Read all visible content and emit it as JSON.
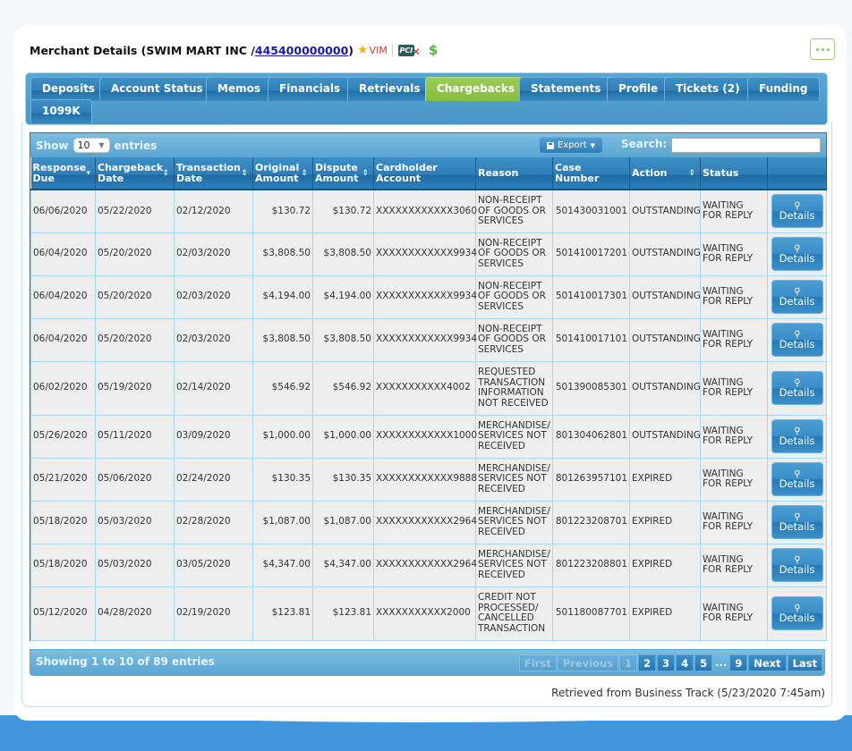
{
  "header": {
    "title_prefix": "Merchant Details (SWIM MART INC / ",
    "merchant_id": "445400000000",
    "title_suffix": ")",
    "vim_label": "VIM",
    "pci_label": "PCI",
    "dollar_label": "$"
  },
  "tabs": [
    {
      "label": "Deposits",
      "active": false
    },
    {
      "label": "Account Status",
      "active": false
    },
    {
      "label": "Memos",
      "active": false
    },
    {
      "label": "Financials",
      "active": false
    },
    {
      "label": "Retrievals",
      "active": false
    },
    {
      "label": "Chargebacks",
      "active": true
    },
    {
      "label": "Statements",
      "active": false
    },
    {
      "label": "Profile",
      "active": false
    },
    {
      "label": "Tickets (2)",
      "active": false
    },
    {
      "label": "Funding",
      "active": false
    },
    {
      "label": "1099K",
      "active": false
    }
  ],
  "toolbar": {
    "show_label": "Show",
    "page_length": "10",
    "entries_label": "entries",
    "export_label": "Export",
    "search_label": "Search:",
    "search_value": ""
  },
  "columns": [
    {
      "label": "Response Due",
      "sort": "desc"
    },
    {
      "label": "Chargeback Date",
      "sort": "both"
    },
    {
      "label": "Transaction Date",
      "sort": "both"
    },
    {
      "label": "Original Amount",
      "sort": "both"
    },
    {
      "label": "Dispute Amount",
      "sort": "both"
    },
    {
      "label": "Cardholder Account",
      "sort": "none"
    },
    {
      "label": "Reason",
      "sort": "none"
    },
    {
      "label": "Case Number",
      "sort": "none"
    },
    {
      "label": "Action",
      "sort": "both"
    },
    {
      "label": "Status",
      "sort": "none"
    },
    {
      "label": "",
      "sort": "none"
    }
  ],
  "rows": [
    {
      "response_due": "06/06/2020",
      "chargeback_date": "05/22/2020",
      "transaction_date": "02/12/2020",
      "original_amount": "$130.72",
      "dispute_amount": "$130.72",
      "cardholder_account": "XXXXXXXXXXXX3060",
      "reason": "NON-RECEIPT OF GOODS OR SERVICES",
      "case_number": "501430031001",
      "action": "OUTSTANDING",
      "status": "WAITING FOR REPLY",
      "button": "Details"
    },
    {
      "response_due": "06/04/2020",
      "chargeback_date": "05/20/2020",
      "transaction_date": "02/03/2020",
      "original_amount": "$3,808.50",
      "dispute_amount": "$3,808.50",
      "cardholder_account": "XXXXXXXXXXXX9934",
      "reason": "NON-RECEIPT OF GOODS OR SERVICES",
      "case_number": "501410017201",
      "action": "OUTSTANDING",
      "status": "WAITING FOR REPLY",
      "button": "Details"
    },
    {
      "response_due": "06/04/2020",
      "chargeback_date": "05/20/2020",
      "transaction_date": "02/03/2020",
      "original_amount": "$4,194.00",
      "dispute_amount": "$4,194.00",
      "cardholder_account": "XXXXXXXXXXXX9934",
      "reason": "NON-RECEIPT OF GOODS OR SERVICES",
      "case_number": "501410017301",
      "action": "OUTSTANDING",
      "status": "WAITING FOR REPLY",
      "button": "Details"
    },
    {
      "response_due": "06/04/2020",
      "chargeback_date": "05/20/2020",
      "transaction_date": "02/03/2020",
      "original_amount": "$3,808.50",
      "dispute_amount": "$3,808.50",
      "cardholder_account": "XXXXXXXXXXXX9934",
      "reason": "NON-RECEIPT OF GOODS OR SERVICES",
      "case_number": "501410017101",
      "action": "OUTSTANDING",
      "status": "WAITING FOR REPLY",
      "button": "Details"
    },
    {
      "response_due": "06/02/2020",
      "chargeback_date": "05/19/2020",
      "transaction_date": "02/14/2020",
      "original_amount": "$546.92",
      "dispute_amount": "$546.92",
      "cardholder_account": "XXXXXXXXXXX4002",
      "reason": "REQUESTED TRANSACTION INFORMATION NOT RECEIVED",
      "case_number": "501390085301",
      "action": "OUTSTANDING",
      "status": "WAITING FOR REPLY",
      "button": "Details"
    },
    {
      "response_due": "05/26/2020",
      "chargeback_date": "05/11/2020",
      "transaction_date": "03/09/2020",
      "original_amount": "$1,000.00",
      "dispute_amount": "$1,000.00",
      "cardholder_account": "XXXXXXXXXXXX1000",
      "reason": "MERCHANDISE/ SERVICES NOT RECEIVED",
      "case_number": "801304062801",
      "action": "OUTSTANDING",
      "status": "WAITING FOR REPLY",
      "button": "Details"
    },
    {
      "response_due": "05/21/2020",
      "chargeback_date": "05/06/2020",
      "transaction_date": "02/24/2020",
      "original_amount": "$130.35",
      "dispute_amount": "$130.35",
      "cardholder_account": "XXXXXXXXXXXX9888",
      "reason": "MERCHANDISE/ SERVICES NOT RECEIVED",
      "case_number": "801263957101",
      "action": "EXPIRED",
      "status": "WAITING FOR REPLY",
      "button": "Details"
    },
    {
      "response_due": "05/18/2020",
      "chargeback_date": "05/03/2020",
      "transaction_date": "02/28/2020",
      "original_amount": "$1,087.00",
      "dispute_amount": "$1,087.00",
      "cardholder_account": "XXXXXXXXXXXX2964",
      "reason": "MERCHANDISE/ SERVICES NOT RECEIVED",
      "case_number": "801223208701",
      "action": "EXPIRED",
      "status": "WAITING FOR REPLY",
      "button": "Details"
    },
    {
      "response_due": "05/18/2020",
      "chargeback_date": "05/03/2020",
      "transaction_date": "03/05/2020",
      "original_amount": "$4,347.00",
      "dispute_amount": "$4,347.00",
      "cardholder_account": "XXXXXXXXXXXX2964",
      "reason": "MERCHANDISE/ SERVICES NOT RECEIVED",
      "case_number": "801223208801",
      "action": "EXPIRED",
      "status": "WAITING FOR REPLY",
      "button": "Details"
    },
    {
      "response_due": "05/12/2020",
      "chargeback_date": "04/28/2020",
      "transaction_date": "02/19/2020",
      "original_amount": "$123.81",
      "dispute_amount": "$123.81",
      "cardholder_account": "XXXXXXXXXXX2000",
      "reason": "CREDIT NOT PROCESSED/ CANCELLED TRANSACTION",
      "case_number": "501180087701",
      "action": "EXPIRED",
      "status": "WAITING FOR REPLY",
      "button": "Details"
    }
  ],
  "footer": {
    "info": "Showing 1 to 10 of 89 entries",
    "pager": [
      {
        "label": "First",
        "state": "disabled"
      },
      {
        "label": "Previous",
        "state": "disabled"
      },
      {
        "label": "1",
        "state": "current"
      },
      {
        "label": "2",
        "state": "normal"
      },
      {
        "label": "3",
        "state": "normal"
      },
      {
        "label": "4",
        "state": "normal"
      },
      {
        "label": "5",
        "state": "normal"
      },
      {
        "label": "...",
        "state": "ellipsis"
      },
      {
        "label": "9",
        "state": "normal"
      },
      {
        "label": "Next",
        "state": "normal"
      },
      {
        "label": "Last",
        "state": "normal"
      }
    ],
    "retrieved": "Retrieved from Business Track (5/23/2020 7:45am)"
  },
  "colors": {
    "active_tab": "#8cc04a",
    "tab_blue": "#2f7eb8",
    "link": "#1a1aa8",
    "vim_red": "#d23d2e",
    "dollar_green": "#57b437",
    "bottom_band": "#4296db"
  }
}
